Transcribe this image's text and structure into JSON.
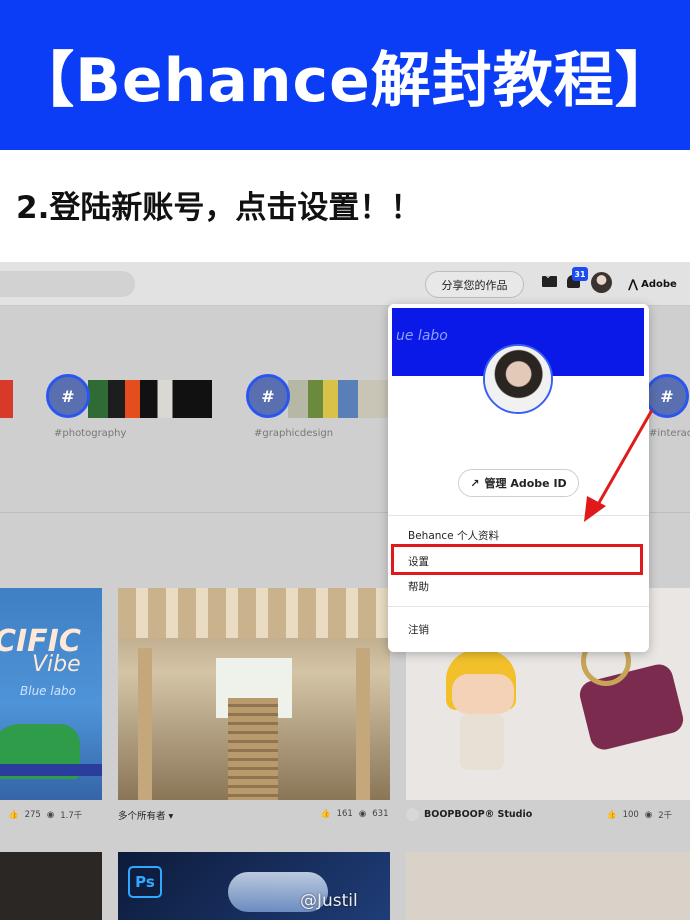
{
  "banner": {
    "title": "【Behance解封教程】"
  },
  "step": {
    "text": "2.登陆新账号，点击设置！！"
  },
  "topbar": {
    "share_button": "分享您的作品",
    "notification_count": "31",
    "adobe_label": "Adobe"
  },
  "tags": [
    {
      "label": "#photography"
    },
    {
      "label": "#graphicdesign"
    },
    {
      "label": "#interacti"
    }
  ],
  "dropdown": {
    "cover_text": "ue labo",
    "manage_button": "管理 Adobe ID",
    "items": [
      "Behance 个人资料",
      "设置",
      "帮助",
      "注销"
    ]
  },
  "cards": [
    {
      "title_a": "CIFIC",
      "title_b": "Vibe",
      "title_c": "Blue labo",
      "likes": "275",
      "views": "1.7千"
    },
    {
      "owner": "多个所有者 ▾",
      "likes": "161",
      "views": "631"
    },
    {
      "owner": "BOOPBOOP® Studio",
      "likes": "100",
      "views": "2千"
    }
  ],
  "bottom": {
    "ps_label": "Ps"
  },
  "watermark": "@Justil"
}
